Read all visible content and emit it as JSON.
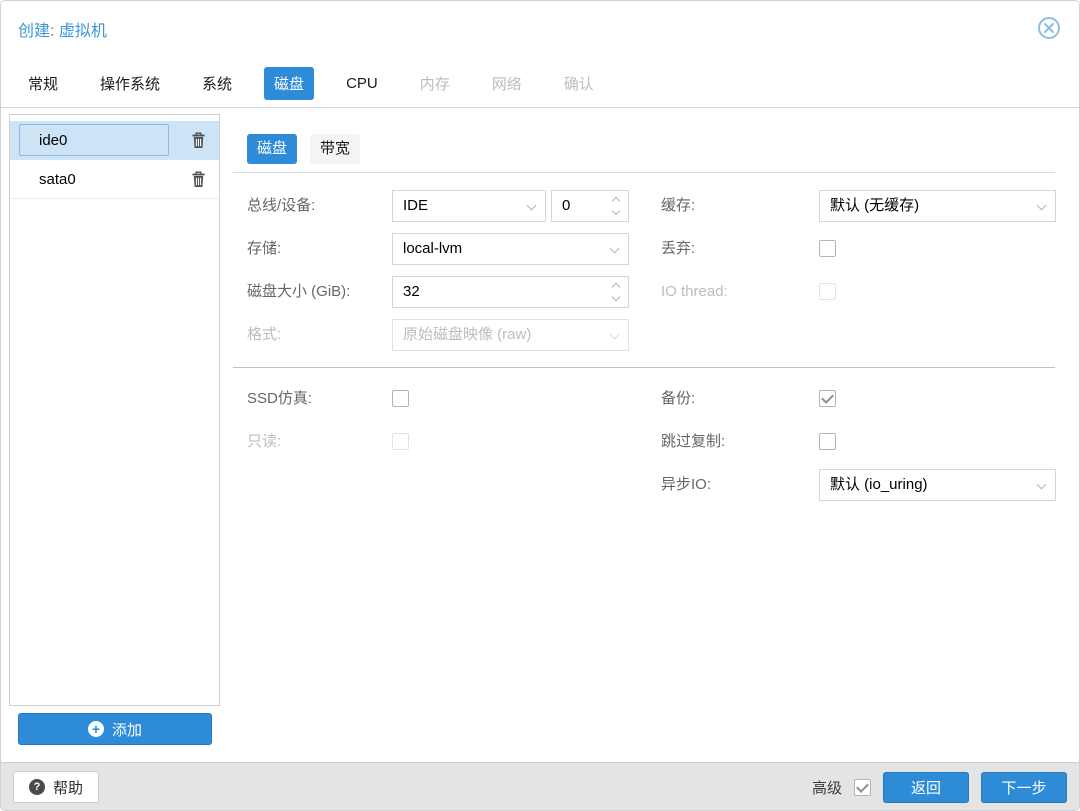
{
  "colors": {
    "accent": "#2e8bd8",
    "accent-border": "#2678ba",
    "title-blue": "#3d96d6",
    "footer-bg": "#e4e4e4",
    "border": "#d2d2d2",
    "selected-row-bg": "#cde3f6",
    "selected-cell-border": "#8ab9e2",
    "label": "#666666",
    "disabled": "#bdbdbd",
    "check": "#8f8f8f"
  },
  "window": {
    "title": "创建: 虚拟机",
    "close_icon": "circle-x"
  },
  "tabs": [
    {
      "label": "常规",
      "state": ""
    },
    {
      "label": "操作系统",
      "state": ""
    },
    {
      "label": "系统",
      "state": ""
    },
    {
      "label": "磁盘",
      "state": "active"
    },
    {
      "label": "CPU",
      "state": ""
    },
    {
      "label": "内存",
      "state": "disabled"
    },
    {
      "label": "网络",
      "state": "disabled"
    },
    {
      "label": "确认",
      "state": "disabled"
    }
  ],
  "disks": {
    "rows": [
      {
        "name": "ide0",
        "state": "selected",
        "delete_icon": "trash"
      },
      {
        "name": "sata0",
        "state": "plain",
        "delete_icon": "trash"
      }
    ],
    "add_label": "添加",
    "add_glyph": "+"
  },
  "subtabs": [
    {
      "label": "磁盘",
      "state": "active"
    },
    {
      "label": "带宽",
      "state": ""
    }
  ],
  "form": {
    "bus_device": {
      "label": "总线/设备:",
      "value": "IDE",
      "device_number": "0"
    },
    "storage": {
      "label": "存储:",
      "value": "local-lvm"
    },
    "disk_size": {
      "label": "磁盘大小 (GiB):",
      "value": "32"
    },
    "format": {
      "label": "格式:",
      "value": "原始磁盘映像 (raw)",
      "state": "disabled"
    },
    "cache": {
      "label": "缓存:",
      "value": "默认 (无缓存)"
    },
    "discard": {
      "label": "丢弃:",
      "state": ""
    },
    "io_thread": {
      "label": "IO thread:",
      "state": "disabled"
    },
    "ssd_emulation": {
      "label": "SSD仿真:",
      "state": ""
    },
    "read_only": {
      "label": "只读:",
      "state": "disabled"
    },
    "backup": {
      "label": "备份:",
      "state": "checked"
    },
    "skip_replication": {
      "label": "跳过复制:",
      "state": ""
    },
    "async_io": {
      "label": "异步IO:",
      "value": "默认 (io_uring)"
    }
  },
  "footer": {
    "help_label": "帮助",
    "help_glyph": "?",
    "advanced_label": "高级",
    "advanced_state": "checked",
    "back_label": "返回",
    "next_label": "下一步"
  }
}
